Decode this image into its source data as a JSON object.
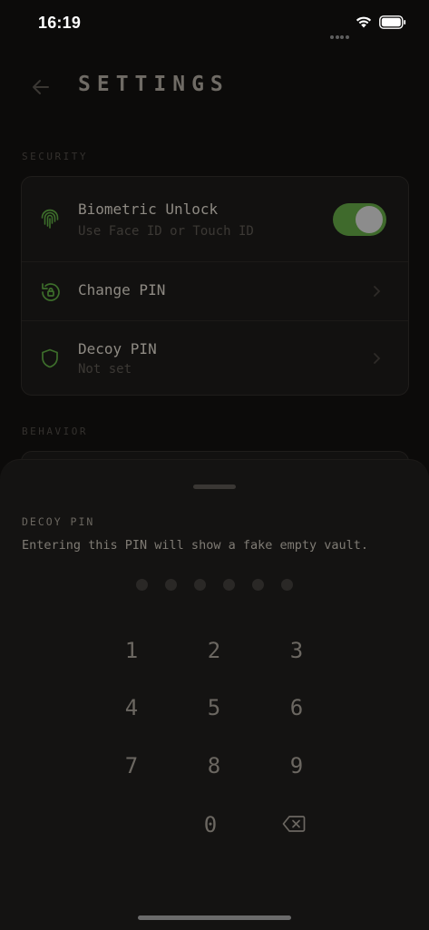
{
  "status_bar": {
    "time": "16:19"
  },
  "header": {
    "title": "SETTINGS"
  },
  "security": {
    "section_label": "SECURITY",
    "biometric": {
      "title": "Biometric Unlock",
      "subtitle": "Use Face ID or Touch ID",
      "enabled": true
    },
    "change_pin": {
      "title": "Change PIN"
    },
    "decoy_pin": {
      "title": "Decoy PIN",
      "subtitle": "Not set"
    }
  },
  "behavior": {
    "section_label": "BEHAVIOR"
  },
  "sheet": {
    "label": "DECOY PIN",
    "description": "Entering this PIN will show a fake empty vault.",
    "pin_length": 6,
    "digits_entered": 0,
    "keys": [
      "1",
      "2",
      "3",
      "4",
      "5",
      "6",
      "7",
      "8",
      "9",
      "0"
    ]
  },
  "colors": {
    "accent": "#3f6a2c",
    "icon_green": "#3d6e2b",
    "background": "#0c0b0a"
  }
}
